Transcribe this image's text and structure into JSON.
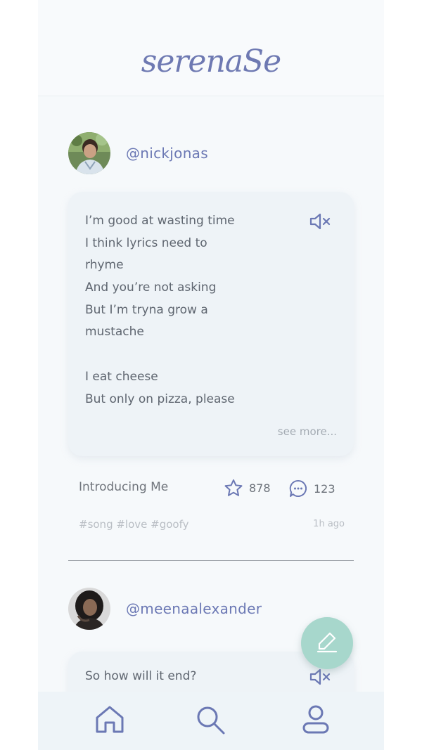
{
  "app": {
    "logo_text": "serenaSe"
  },
  "colors": {
    "accent": "#6b78b4",
    "fab": "#a7d7cc",
    "card": "#eef3f7",
    "text": "#5f6670"
  },
  "posts": [
    {
      "username": "@nickjonas",
      "lyrics": [
        "I’m good at wasting time",
        "I think lyrics need to",
        "rhyme",
        "And you’re not asking",
        "But I’m tryna grow a",
        "mustache",
        "",
        "I eat cheese",
        "But only on pizza, please"
      ],
      "see_more": "see more...",
      "song_title": "Introducing Me",
      "stars": "878",
      "comments": "123",
      "tags": "#song #love #goofy",
      "time_ago": "1h ago"
    },
    {
      "username": "@meenaalexander",
      "lyrics": [
        "So how will it end?"
      ]
    }
  ],
  "icons": {
    "mute": "speaker-mute-icon",
    "star": "star-icon",
    "comment": "comment-icon",
    "fab": "pencil-icon",
    "nav_home": "home-icon",
    "nav_search": "search-icon",
    "nav_profile": "profile-icon"
  }
}
